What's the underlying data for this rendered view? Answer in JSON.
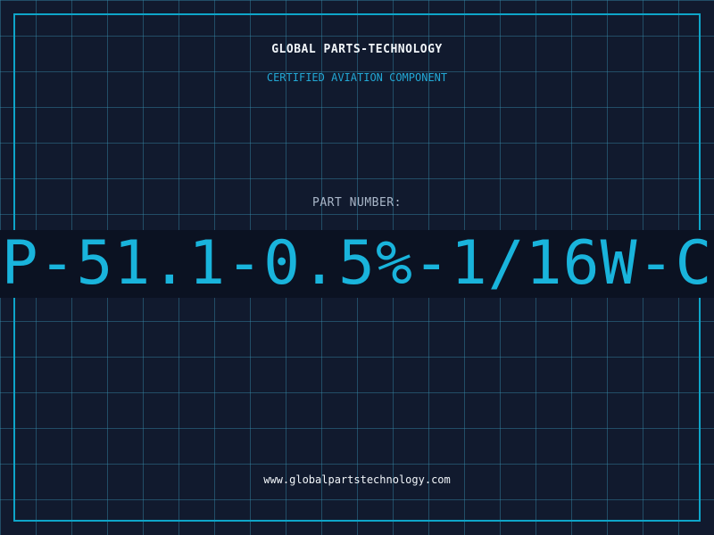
{
  "header": {
    "brand": "GLOBAL PARTS-TECHNOLOGY",
    "tagline": "CERTIFIED AVIATION COMPONENT"
  },
  "part": {
    "label": "PART NUMBER:",
    "number": "P-51.1-0.5%-1/16W-C"
  },
  "footer": {
    "url": "www.globalpartstechnology.com"
  },
  "colors": {
    "background": "#111a2e",
    "grid": "#388caa",
    "frame": "#0ea5c9",
    "accent": "#19b4dc",
    "text": "#f1f5f9",
    "muted": "#a9b6c8"
  }
}
